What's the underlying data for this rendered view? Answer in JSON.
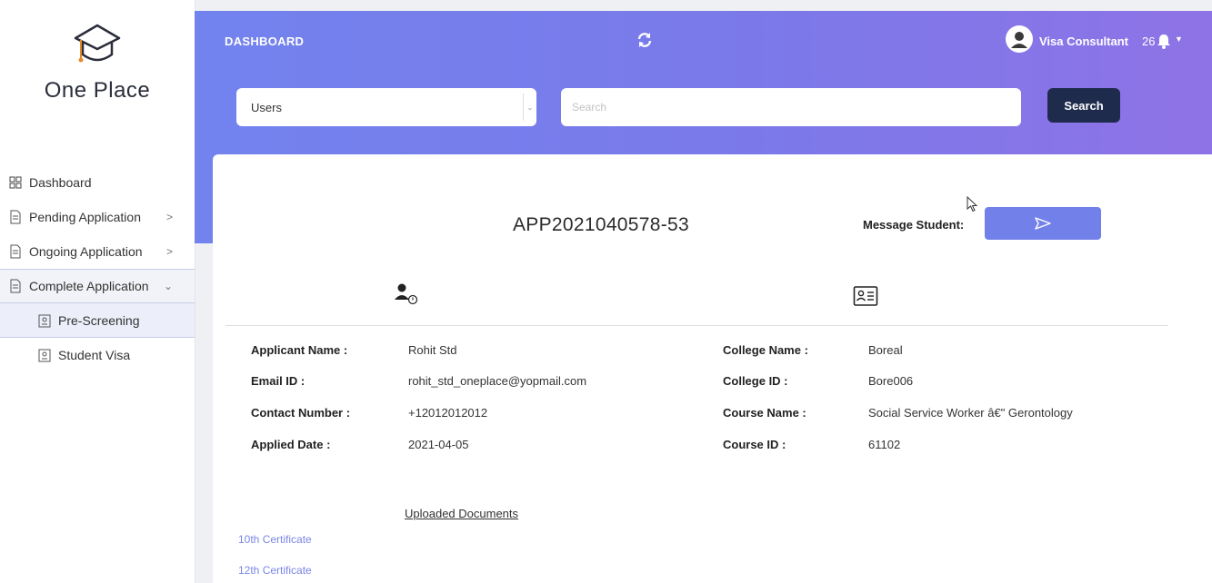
{
  "sidebar": {
    "logo_text": "One Place",
    "items": [
      {
        "label": "Dashboard",
        "icon": "grid-icon"
      },
      {
        "label": "Pending Application",
        "icon": "document-icon",
        "chevron": ">"
      },
      {
        "label": "Ongoing Application",
        "icon": "document-icon",
        "chevron": ">"
      },
      {
        "label": "Complete Application",
        "icon": "document-icon",
        "chevron": "⌄"
      }
    ],
    "subitems": [
      {
        "label": "Pre-Screening",
        "icon": "id-badge-icon"
      },
      {
        "label": "Student Visa",
        "icon": "id-badge-icon"
      }
    ]
  },
  "header": {
    "title": "DASHBOARD",
    "user_name": "Visa Consultant",
    "notification_count": "26",
    "select_value": "Users",
    "search_placeholder": "Search",
    "search_button": "Search"
  },
  "application": {
    "id": "APP2021040578-53",
    "message_label": "Message Student:",
    "applicant": [
      {
        "label": "Applicant Name :",
        "value": "Rohit Std"
      },
      {
        "label": "Email ID :",
        "value": "rohit_std_oneplace@yopmail.com"
      },
      {
        "label": "Contact Number :",
        "value": "+12012012012"
      },
      {
        "label": "Applied Date :",
        "value": "2021-04-05"
      }
    ],
    "college": [
      {
        "label": "College Name :",
        "value": "Boreal"
      },
      {
        "label": "College ID :",
        "value": "Bore006"
      },
      {
        "label": "Course Name :",
        "value": "Social Service Worker â€\" Gerontology"
      },
      {
        "label": "Course ID :",
        "value": "61102"
      }
    ],
    "documents_title": "Uploaded Documents",
    "documents": [
      "10th Certificate",
      "12th Certificate"
    ]
  },
  "colors": {
    "accent": "#7280ea",
    "header_start": "#7283ee",
    "header_end": "#8e73e6",
    "search_button": "#1f2b4d"
  }
}
